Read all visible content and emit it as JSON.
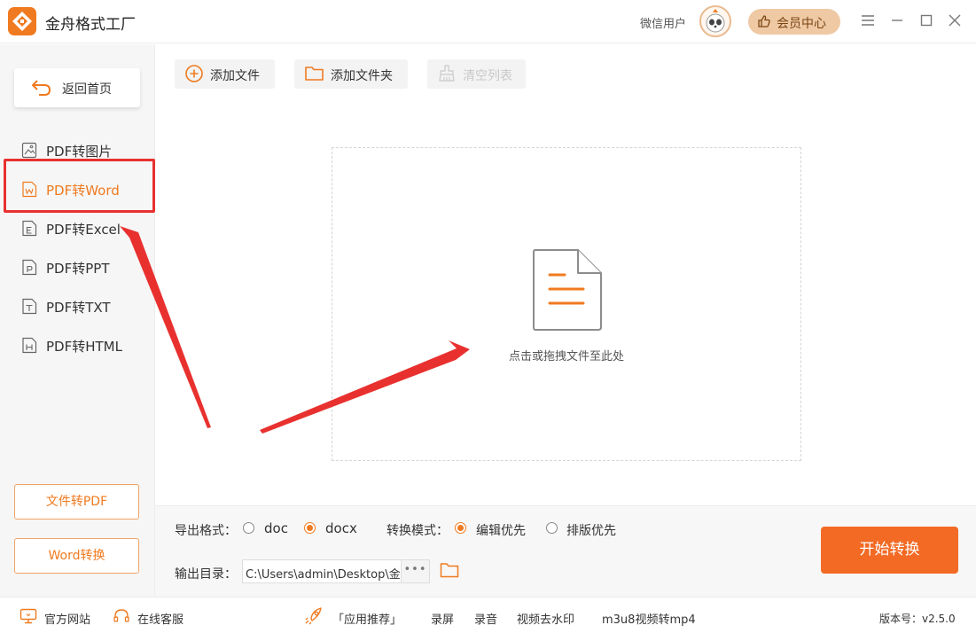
{
  "titlebar": {
    "app_title": "金舟格式工厂",
    "user_name": "微信用户",
    "vip_label": "会员中心"
  },
  "sidebar": {
    "back_label": "返回首页",
    "items": [
      {
        "label": "PDF转图片",
        "icon": "image-file-icon",
        "active": false
      },
      {
        "label": "PDF转Word",
        "icon": "word-file-icon",
        "active": true
      },
      {
        "label": "PDF转Excel",
        "icon": "excel-file-icon",
        "active": false
      },
      {
        "label": "PDF转PPT",
        "icon": "ppt-file-icon",
        "active": false
      },
      {
        "label": "PDF转TXT",
        "icon": "txt-file-icon",
        "active": false
      },
      {
        "label": "PDF转HTML",
        "icon": "html-file-icon",
        "active": false
      }
    ],
    "file_to_pdf_label": "文件转PDF",
    "word_convert_label": "Word转换"
  },
  "toolbar": {
    "add_file_label": "添加文件",
    "add_folder_label": "添加文件夹",
    "clear_list_label": "清空列表"
  },
  "dropzone": {
    "hint": "点击或拖拽文件至此处"
  },
  "settings": {
    "export_format_label": "导出格式：",
    "format_options": [
      {
        "label": "doc",
        "checked": false
      },
      {
        "label": "docx",
        "checked": true
      }
    ],
    "mode_label": "转换模式：",
    "mode_options": [
      {
        "label": "编辑优先",
        "checked": true
      },
      {
        "label": "排版优先",
        "checked": false
      }
    ],
    "output_dir_label": "输出目录：",
    "output_dir_value": "C:\\Users\\admin\\Desktop\\金舟格式工厂",
    "browse_label": "•••",
    "start_label": "开始转换"
  },
  "footer": {
    "website": "官方网站",
    "support": "在线客服",
    "recommend": "「应用推荐」",
    "links": [
      "录屏",
      "录音",
      "视频去水印",
      "m3u8视频转mp4"
    ],
    "version": "版本号：v2.5.0"
  },
  "colors": {
    "accent": "#f07a1f",
    "start_button": "#f26a24",
    "annotation": "#e8312f"
  }
}
